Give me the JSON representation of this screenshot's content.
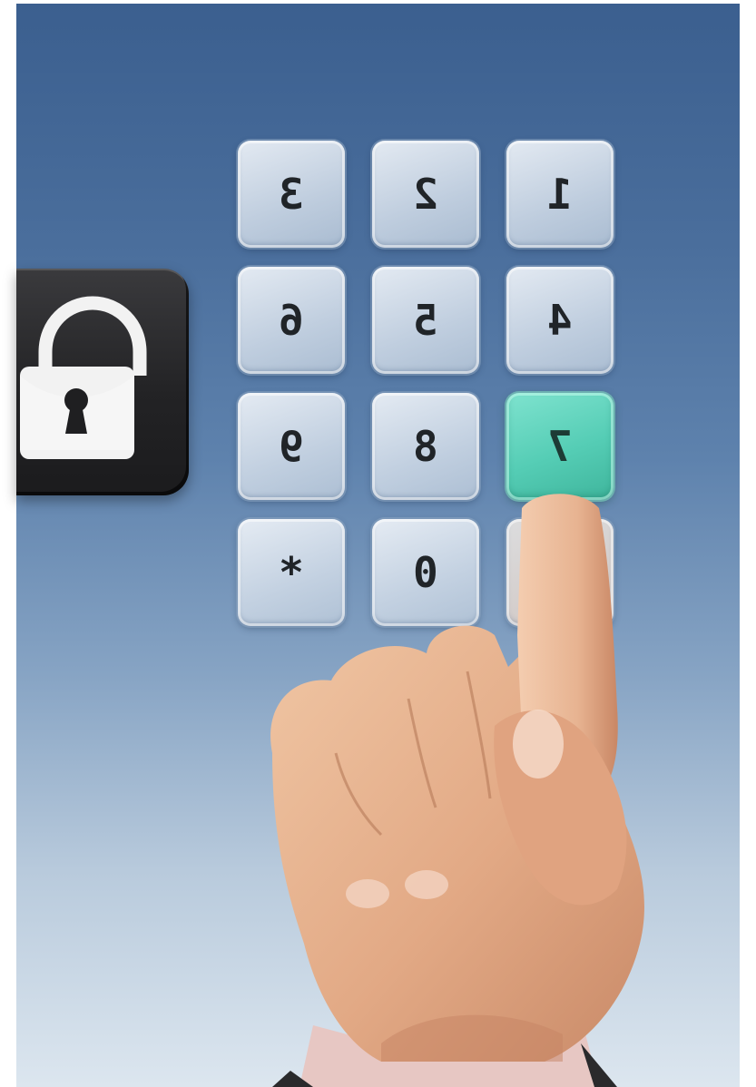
{
  "scene": {
    "description_colors": {
      "background_top": "#3b5f8f",
      "background_bottom": "#dce6ef",
      "key_face": "#cbd7e5",
      "key_active": "#55cdb5",
      "lock_tile": "#232325",
      "padlock": "#f2f2f2",
      "skin": "#e4b08e"
    },
    "icons": {
      "lock": "padlock-icon"
    }
  },
  "keypad": {
    "active_key_index": 8,
    "keys": [
      {
        "label": "3",
        "mirrored": true
      },
      {
        "label": "2",
        "mirrored": true
      },
      {
        "label": "1",
        "mirrored": true
      },
      {
        "label": "6",
        "mirrored": true
      },
      {
        "label": "5",
        "mirrored": true
      },
      {
        "label": "4",
        "mirrored": true
      },
      {
        "label": "9",
        "mirrored": true
      },
      {
        "label": "8",
        "mirrored": true
      },
      {
        "label": "7",
        "mirrored": true
      },
      {
        "label": "*",
        "mirrored": false
      },
      {
        "label": "0",
        "mirrored": true
      },
      {
        "label": "#",
        "mirrored": false
      }
    ]
  }
}
